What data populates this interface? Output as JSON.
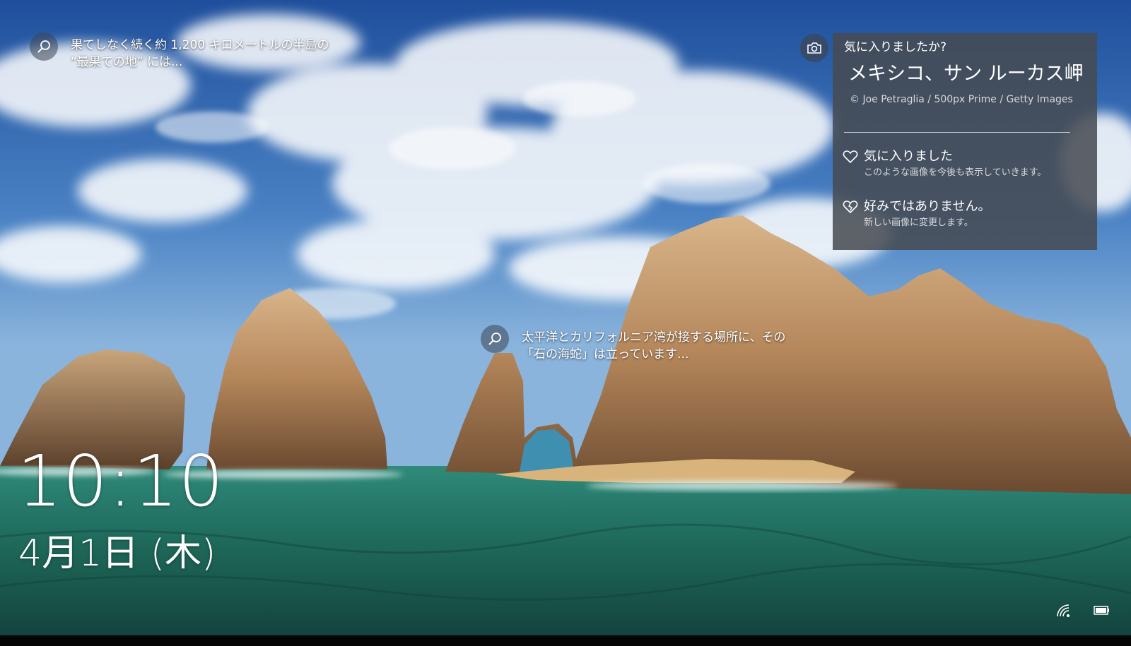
{
  "spotlight": {
    "hotspots": [
      {
        "text_line1": "果てしなく続く約 1,200 キロメートルの半島の",
        "text_line2": "“最果ての地” には..."
      },
      {
        "text_line1": "太平洋とカリフォルニア湾が接する場所に、その",
        "text_line2": "「石の海蛇」は立っています..."
      }
    ],
    "panel": {
      "question": "気に入りましたか?",
      "location": "メキシコ、サン ルーカス岬",
      "credit": "© Joe Petraglia / 500px Prime / Getty Images",
      "options": [
        {
          "title": "気に入りました",
          "subtitle": "このような画像を今後も表示していきます。",
          "icon": "heart-icon"
        },
        {
          "title": "好みではありません。",
          "subtitle": "新しい画像に変更します。",
          "icon": "heart-dislike-icon"
        }
      ]
    }
  },
  "lockscreen": {
    "time": "10:10",
    "date": "4月1日 (木)"
  },
  "status": {
    "icons": [
      "network-icon",
      "battery-icon"
    ]
  },
  "colors": {
    "sky_top": "#2a5ea8",
    "sea": "#1f6b5c",
    "rock": "#b98a5c",
    "panel_bg": "#464a52"
  }
}
